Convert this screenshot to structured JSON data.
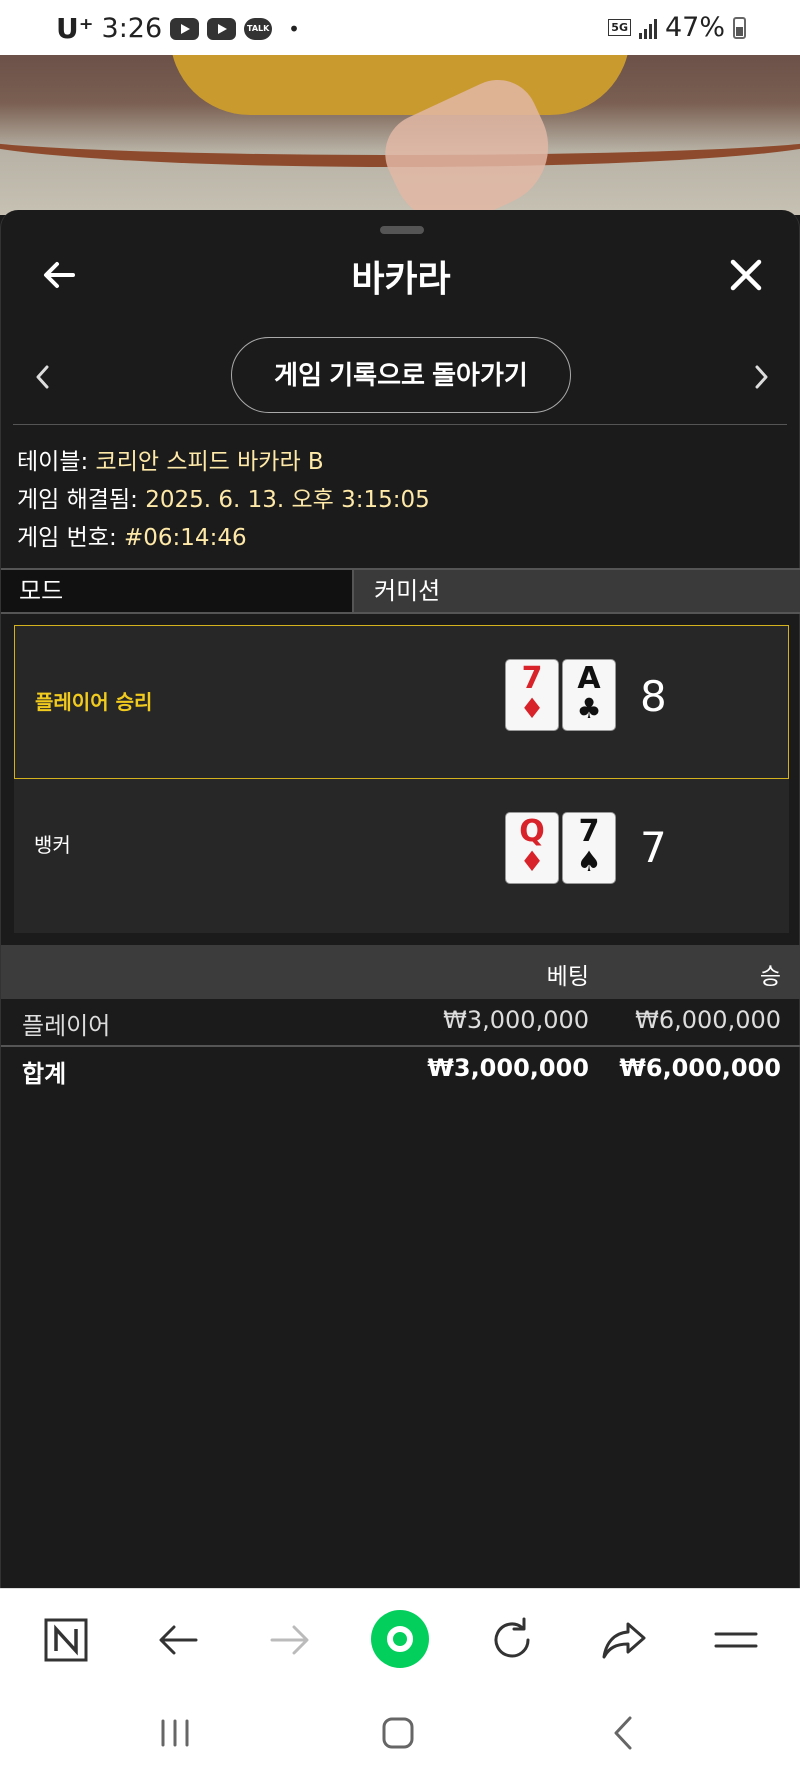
{
  "status_bar": {
    "carrier": "U⁺",
    "time": "3:26",
    "network": "5G",
    "battery": "47%"
  },
  "header": {
    "title": "바카라"
  },
  "navigation": {
    "back_to_history_label": "게임 기록으로 돌아가기"
  },
  "info": {
    "table_label": "테이블:",
    "table_value": "코리안 스피드 바카라 B",
    "resolved_label": "게임 해결됨:",
    "resolved_value": "2025. 6. 13. 오후 3:15:05",
    "game_no_label": "게임 번호:",
    "game_no_value": "#06:14:46"
  },
  "mode": {
    "left_label": "모드",
    "right_label": "커미션"
  },
  "results": {
    "player": {
      "label": "플레이어 승리",
      "cards": [
        {
          "rank": "7",
          "suit": "♦",
          "color": "#d8232a"
        },
        {
          "rank": "A",
          "suit": "♣",
          "color": "#111111"
        }
      ],
      "score": "8"
    },
    "banker": {
      "label": "뱅커",
      "cards": [
        {
          "rank": "Q",
          "suit": "♦",
          "color": "#d8232a"
        },
        {
          "rank": "7",
          "suit": "♠",
          "color": "#111111"
        }
      ],
      "score": "7"
    }
  },
  "bets_table": {
    "col_bet": "베팅",
    "col_win": "승",
    "rows": [
      {
        "name": "플레이어",
        "bet": "₩3,000,000",
        "win": "₩6,000,000"
      }
    ],
    "total": {
      "name": "합계",
      "bet": "₩3,000,000",
      "win": "₩6,000,000"
    }
  },
  "colors": {
    "winner_accent": "#f2cb1f",
    "background": "#1b1b1b",
    "browser_home_green": "#03cf5d"
  },
  "browser_bar": {
    "icons": [
      "naver-n-icon",
      "arrow-left-icon",
      "arrow-right-icon",
      "green-home-icon",
      "refresh-icon",
      "share-icon",
      "menu-icon"
    ]
  }
}
